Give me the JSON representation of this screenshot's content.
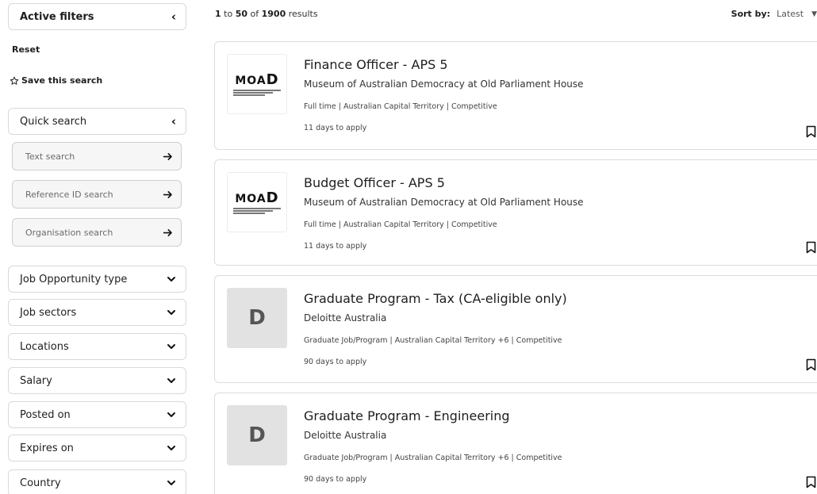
{
  "sidebar": {
    "active_filters": {
      "label": "Active filters",
      "icon": "chevron-left-icon"
    },
    "reset_label": "Reset",
    "save_search_label": "Save this search",
    "quick_search": {
      "label": "Quick search",
      "text_search_placeholder": "Text search",
      "reference_search_placeholder": "Reference ID search",
      "organisation_search_placeholder": "Organisation search"
    },
    "filters": [
      {
        "label": "Job Opportunity type"
      },
      {
        "label": "Job sectors"
      },
      {
        "label": "Locations"
      },
      {
        "label": "Salary"
      },
      {
        "label": "Posted on"
      },
      {
        "label": "Expires on"
      },
      {
        "label": "Country"
      }
    ]
  },
  "results": {
    "range_start": "1",
    "to_word": "to",
    "range_end": "50",
    "of_word": "of",
    "total": "1900",
    "results_word": "results"
  },
  "sort": {
    "label": "Sort by:",
    "value": "Latest"
  },
  "jobs": [
    {
      "title": "Finance Officer - APS 5",
      "organisation": "Museum of Australian Democracy at Old Parliament House",
      "meta": "Full time | Australian Capital Territory | Competitive",
      "apply": "11 days to apply",
      "logo_text": "MOAD"
    },
    {
      "title": "Budget Officer - APS 5",
      "organisation": "Museum of Australian Democracy at Old Parliament House",
      "meta": "Full time | Australian Capital Territory | Competitive",
      "apply": "11 days to apply",
      "logo_text": "MOAD"
    },
    {
      "title": "Graduate Program - Tax (CA-eligible only)",
      "organisation": "Deloitte Australia",
      "meta": "Graduate Job/Program | Australian Capital Territory +6 | Competitive",
      "apply": "90 days to apply",
      "logo_text": "D"
    },
    {
      "title": "Graduate Program - Engineering",
      "organisation": "Deloitte Australia",
      "meta": "Graduate Job/Program | Australian Capital Territory +6 | Competitive",
      "apply": "90 days to apply",
      "logo_text": "D"
    }
  ]
}
